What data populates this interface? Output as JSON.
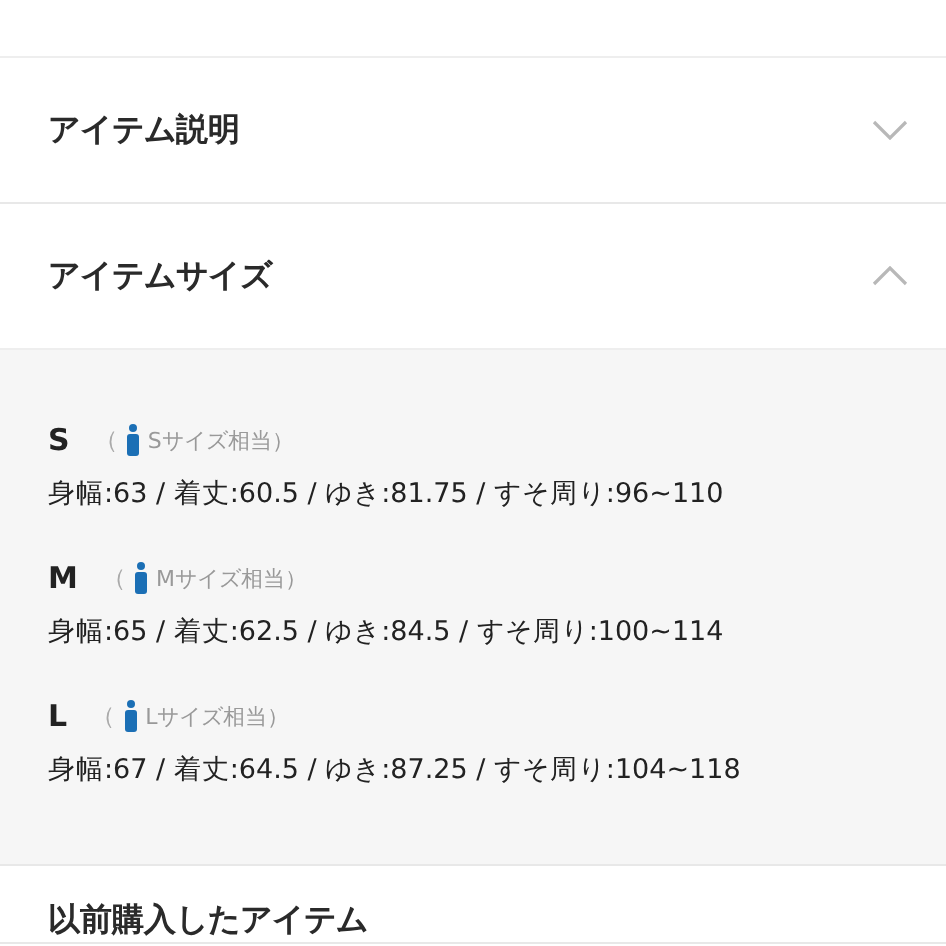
{
  "sections": [
    {
      "title": "アイテム説明",
      "expanded": false
    },
    {
      "title": "アイテムサイズ",
      "expanded": true,
      "sizes": [
        {
          "label": "S",
          "paren": "（",
          "note": "Sサイズ相当）",
          "measurements": "身幅:63 / 着丈:60.5 / ゆき:81.75 / すそ周り:96~110"
        },
        {
          "label": "M",
          "paren": "（",
          "note": "Mサイズ相当）",
          "measurements": "身幅:65 / 着丈:62.5 / ゆき:84.5 / すそ周り:100~114"
        },
        {
          "label": "L",
          "paren": "（",
          "note": "Lサイズ相当）",
          "measurements": "身幅:67 / 着丈:64.5 / ゆき:87.25 / すそ周り:104~118"
        }
      ]
    },
    {
      "title": "以前購入したアイテム"
    }
  ]
}
